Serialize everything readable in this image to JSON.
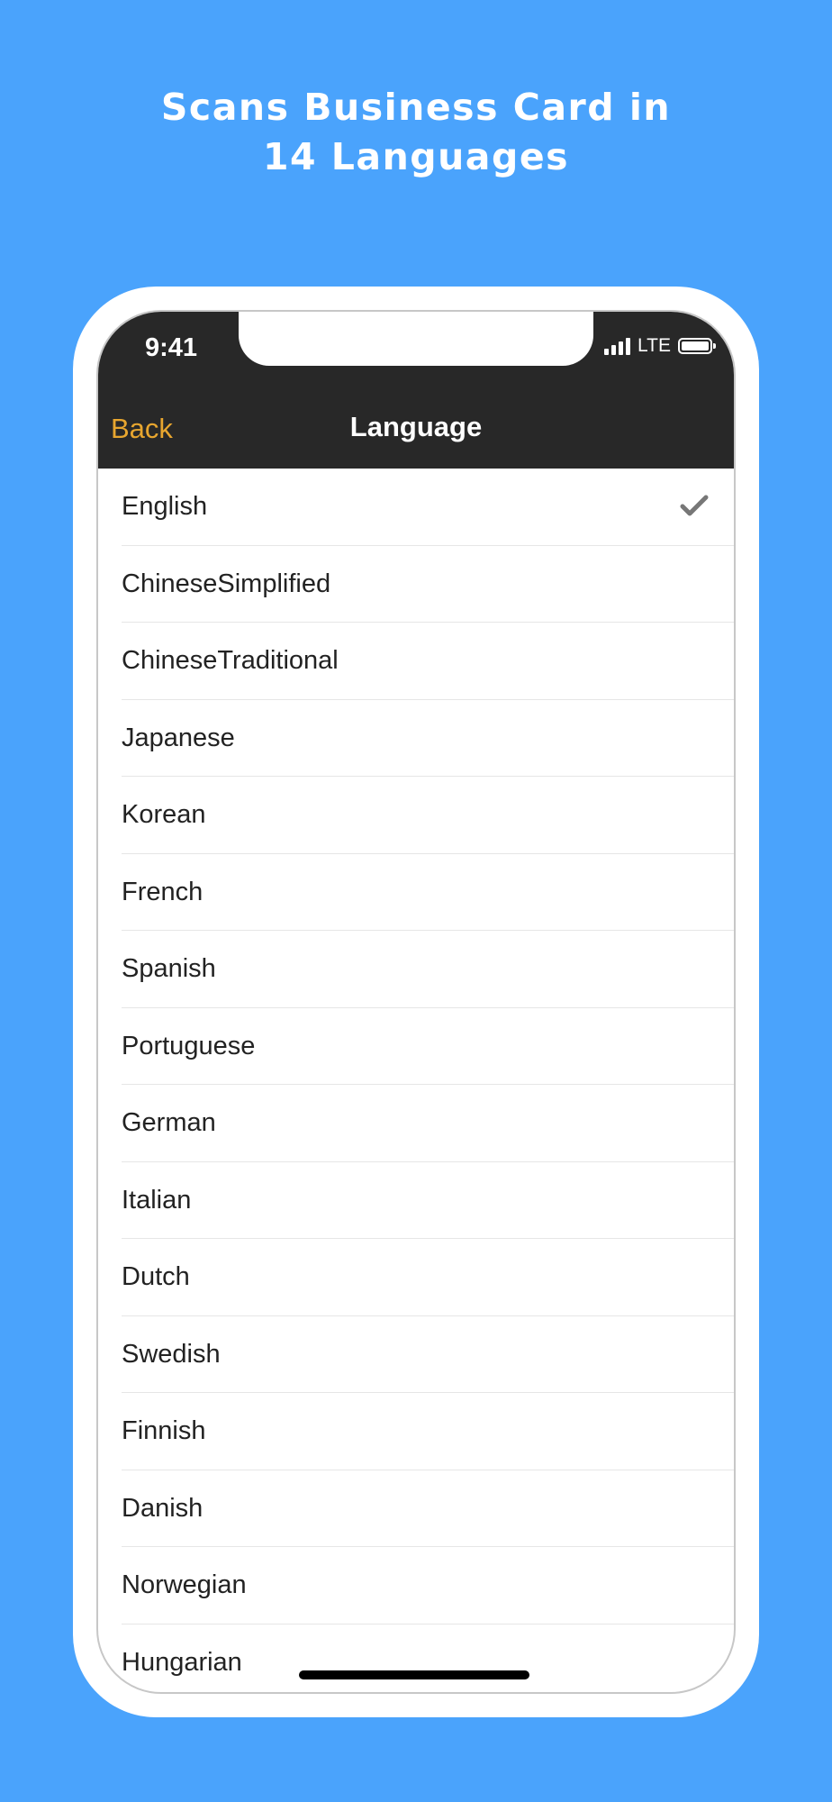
{
  "headline": {
    "line1": "Scans Business Card in",
    "line2": "14 Languages"
  },
  "status_bar": {
    "time": "9:41",
    "network": "LTE",
    "icons": [
      "signal-icon",
      "battery-icon"
    ]
  },
  "nav": {
    "back_label": "Back",
    "title": "Language",
    "back_color": "#e8a62f",
    "bar_color": "#282828"
  },
  "languages": [
    {
      "label": "English",
      "selected": true
    },
    {
      "label": "ChineseSimplified"
    },
    {
      "label": "ChineseTraditional"
    },
    {
      "label": "Japanese"
    },
    {
      "label": "Korean"
    },
    {
      "label": "French"
    },
    {
      "label": "Spanish"
    },
    {
      "label": "Portuguese"
    },
    {
      "label": "German"
    },
    {
      "label": "Italian"
    },
    {
      "label": "Dutch"
    },
    {
      "label": "Swedish"
    },
    {
      "label": "Finnish"
    },
    {
      "label": "Danish"
    },
    {
      "label": "Norwegian"
    },
    {
      "label": "Hungarian"
    }
  ],
  "colors": {
    "background": "#4aa3fc",
    "checkmark": "#777777"
  }
}
